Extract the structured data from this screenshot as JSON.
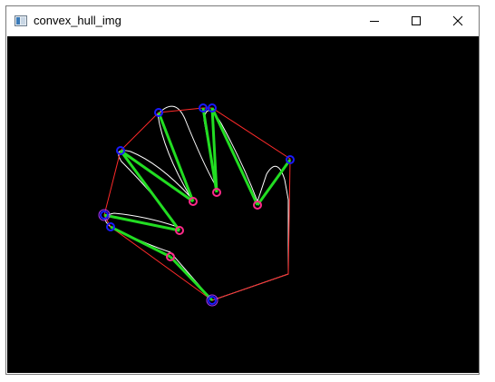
{
  "window": {
    "title": "convex_hull_img",
    "icons": {
      "app": "opencv-window-icon",
      "minimize": "minimize-icon",
      "maximize": "maximize-icon",
      "close": "close-icon"
    }
  },
  "image": {
    "description_colors": {
      "background": "#000000",
      "hand_contour": "#ffffff",
      "convex_hull": "#ff2a2a",
      "defect_lines": "#22dd22",
      "hull_points": "#1a1aff",
      "defect_points": "#ff2a8a",
      "far_ring": "#aa33ff"
    }
  }
}
